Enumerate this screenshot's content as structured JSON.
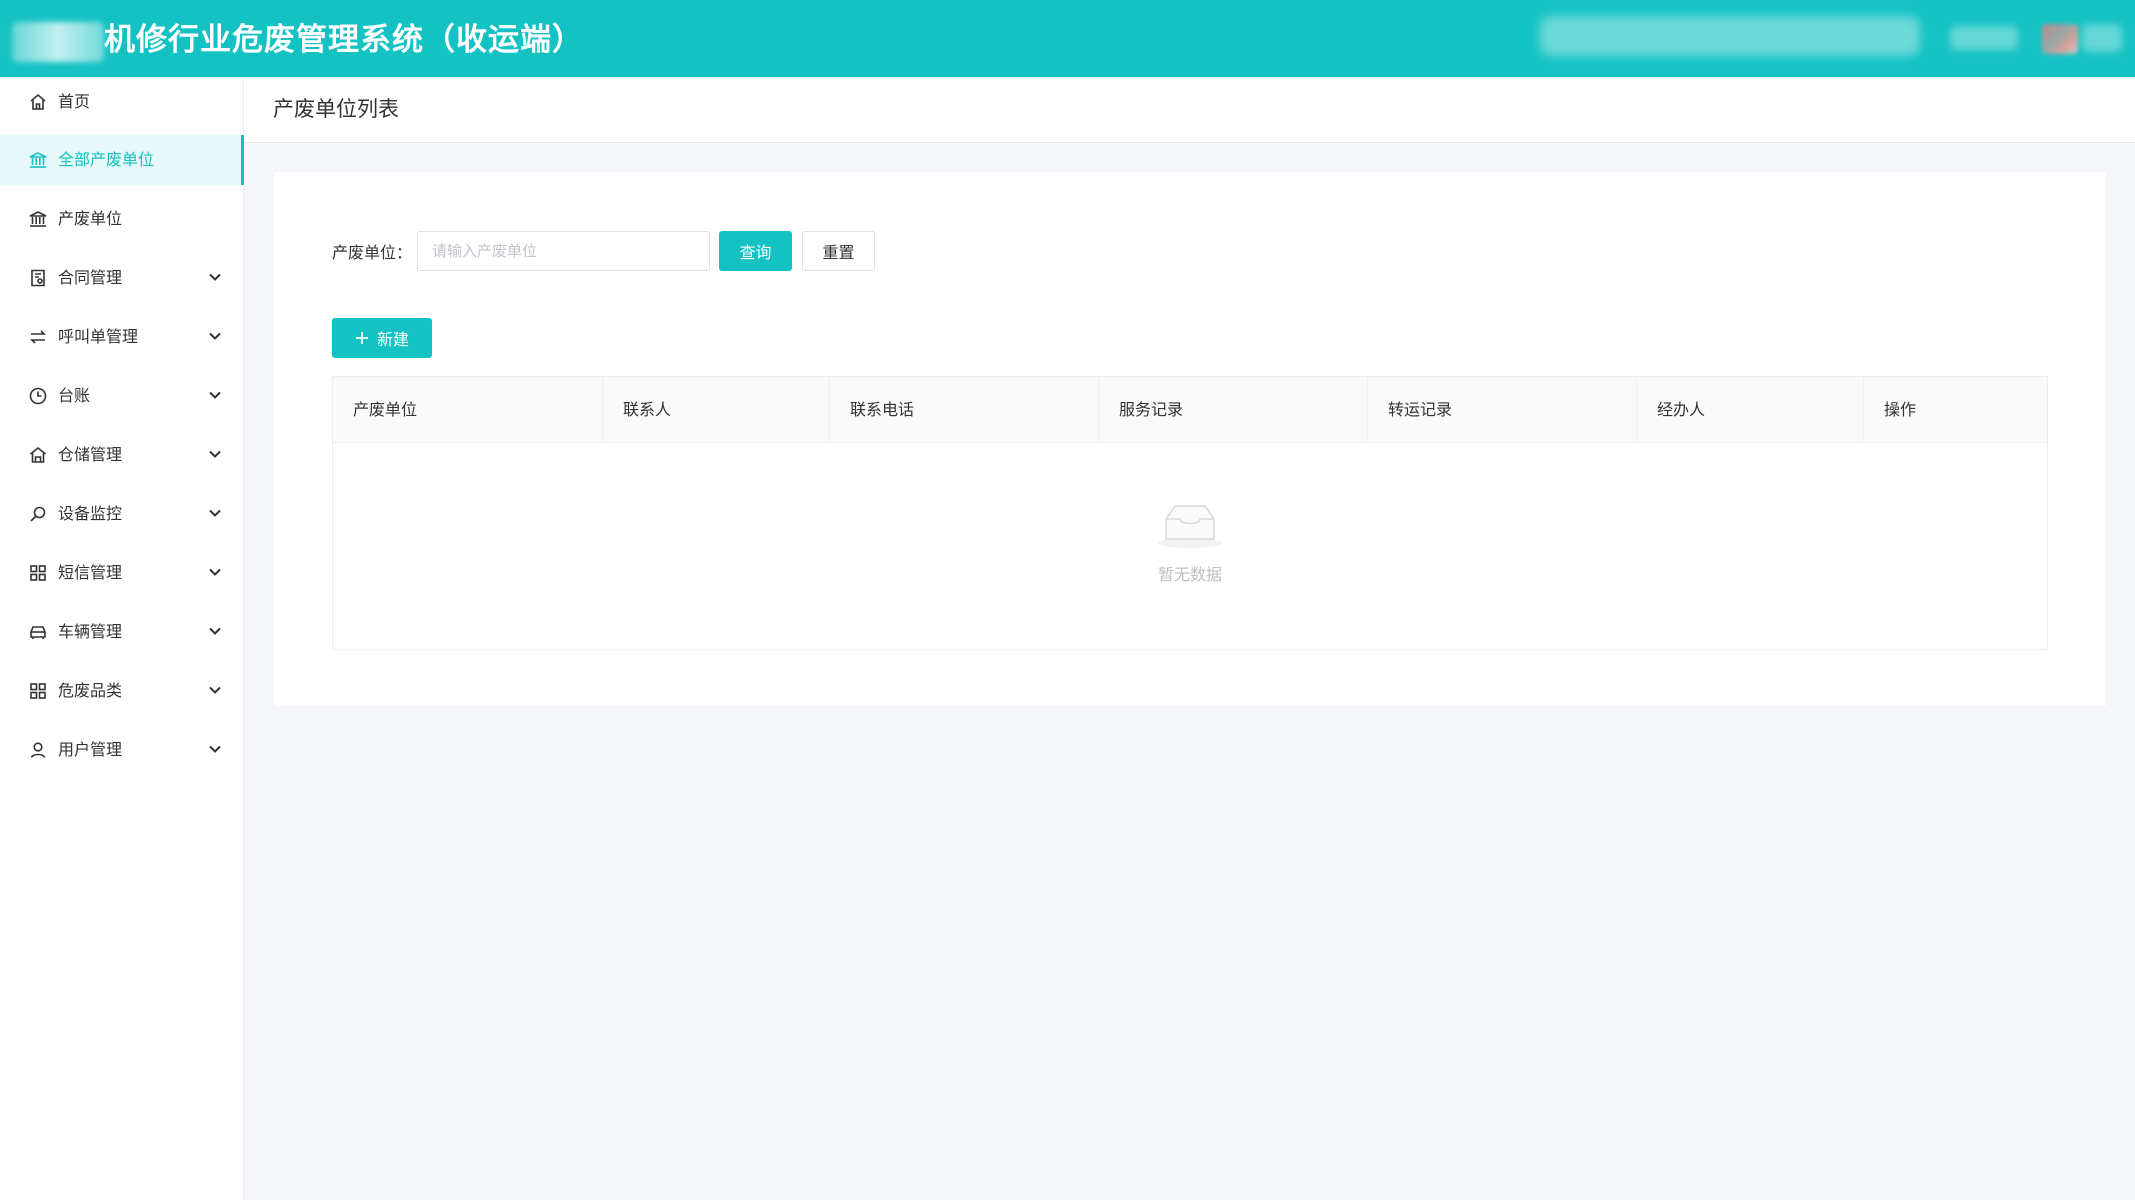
{
  "header": {
    "title": "机修行业危废管理系统（收运端）"
  },
  "sidebar": {
    "items": [
      {
        "label": "首页",
        "icon": "home-icon",
        "active": false,
        "expandable": false
      },
      {
        "label": "全部产废单位",
        "icon": "bank-icon",
        "active": true,
        "expandable": false
      },
      {
        "label": "产废单位",
        "icon": "bank-icon",
        "active": false,
        "expandable": false
      },
      {
        "label": "合同管理",
        "icon": "contract-icon",
        "active": false,
        "expandable": true
      },
      {
        "label": "呼叫单管理",
        "icon": "swap-icon",
        "active": false,
        "expandable": true
      },
      {
        "label": "台账",
        "icon": "clock-icon",
        "active": false,
        "expandable": true
      },
      {
        "label": "仓储管理",
        "icon": "warehouse-icon",
        "active": false,
        "expandable": true
      },
      {
        "label": "设备监控",
        "icon": "search-icon",
        "active": false,
        "expandable": true
      },
      {
        "label": "短信管理",
        "icon": "grid-icon",
        "active": false,
        "expandable": true
      },
      {
        "label": "车辆管理",
        "icon": "car-icon",
        "active": false,
        "expandable": true
      },
      {
        "label": "危废品类",
        "icon": "grid-icon",
        "active": false,
        "expandable": true
      },
      {
        "label": "用户管理",
        "icon": "user-icon",
        "active": false,
        "expandable": true
      }
    ]
  },
  "page": {
    "title": "产废单位列表"
  },
  "search": {
    "label": "产废单位：",
    "placeholder": "请输入产废单位",
    "value": "",
    "query_label": "查询",
    "reset_label": "重置"
  },
  "toolbar": {
    "new_label": "新建"
  },
  "table": {
    "columns": [
      "产废单位",
      "联系人",
      "联系电话",
      "服务记录",
      "转运记录",
      "经办人",
      "操作"
    ],
    "rows": [],
    "empty_text": "暂无数据"
  },
  "colors": {
    "accent": "#14c2c3",
    "active_bg": "#e6f8f8",
    "page_bg": "#f5f6fa"
  }
}
